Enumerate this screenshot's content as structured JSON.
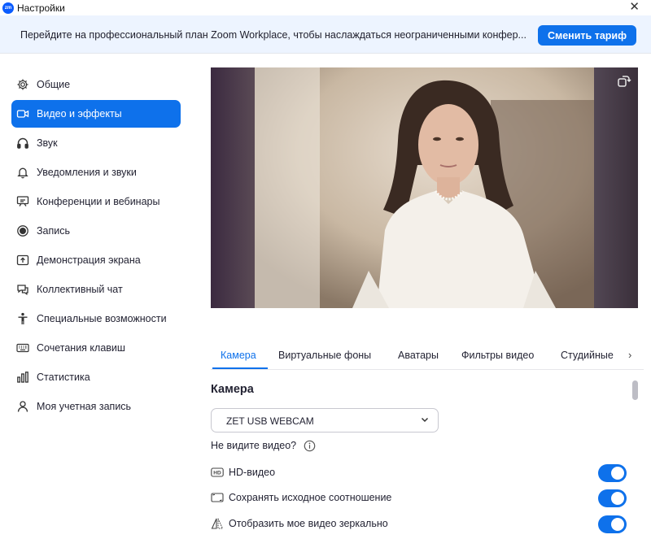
{
  "window": {
    "title": "Настройки",
    "logo_text": "zm",
    "close_symbol": "✕"
  },
  "banner": {
    "message": "Перейдите на профессиональный план Zoom Workplace, чтобы наслаждаться неограниченными конфер...",
    "upgrade_label": "Сменить тариф"
  },
  "sidebar": {
    "items": [
      {
        "label": "Общие",
        "icon": "gear-icon",
        "active": false
      },
      {
        "label": "Видео и эффекты",
        "icon": "video-camera-icon",
        "active": true
      },
      {
        "label": "Звук",
        "icon": "headphones-icon",
        "active": false
      },
      {
        "label": "Уведомления и звуки",
        "icon": "bell-icon",
        "active": false
      },
      {
        "label": "Конференции и вебинары",
        "icon": "presentation-icon",
        "active": false
      },
      {
        "label": "Запись",
        "icon": "record-icon",
        "active": false
      },
      {
        "label": "Демонстрация экрана",
        "icon": "share-screen-icon",
        "active": false
      },
      {
        "label": "Коллективный чат",
        "icon": "chat-icon",
        "active": false
      },
      {
        "label": "Специальные возможности",
        "icon": "accessibility-icon",
        "active": false
      },
      {
        "label": "Сочетания клавиш",
        "icon": "keyboard-icon",
        "active": false
      },
      {
        "label": "Статистика",
        "icon": "statistics-icon",
        "active": false
      },
      {
        "label": "Моя учетная запись",
        "icon": "user-icon",
        "active": false
      }
    ]
  },
  "video": {
    "rotate_icon": "rotate-icon"
  },
  "tabs": {
    "items": [
      "Камера",
      "Виртуальные фоны",
      "Аватары",
      "Фильтры видео",
      "Студийные"
    ],
    "active": "Камера",
    "next_symbol": "›"
  },
  "camera": {
    "section_title": "Камера",
    "selected_device": "ZET USB WEBCAM",
    "help_text": "Не видите видео?",
    "options": [
      {
        "label": "HD-видео",
        "icon": "hd-icon",
        "enabled": true
      },
      {
        "label": "Сохранять исходное соотношение",
        "icon": "aspect-ratio-icon",
        "enabled": true
      },
      {
        "label": "Отобразить мое видео зеркально",
        "icon": "mirror-icon",
        "enabled": true
      }
    ]
  },
  "colors": {
    "accent": "#0e71eb",
    "banner_bg": "#edf4ff"
  }
}
